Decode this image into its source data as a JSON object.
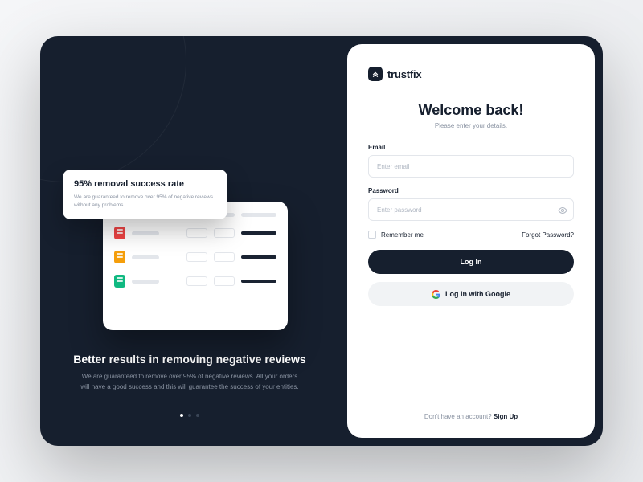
{
  "brand": {
    "name": "trustfix"
  },
  "hero": {
    "callout_title": "95% removal success rate",
    "callout_body": "We are guaranteed to remove over 95% of negative reviews without any problems.",
    "title": "Better results in removing negative reviews",
    "subtitle": "We are guaranteed to remove over 95% of negative reviews. All your orders will have a good success and this will guarantee the success of your entities."
  },
  "auth": {
    "welcome_title": "Welcome back!",
    "welcome_subtitle": "Please enter your details.",
    "email_label": "Email",
    "email_placeholder": "Enter email",
    "password_label": "Password",
    "password_placeholder": "Enter password",
    "remember_label": "Remember me",
    "forgot_label": "Forgot Password?",
    "login_label": "Log In",
    "google_label": "Log In with Google",
    "signup_prompt": "Don't have an account? ",
    "signup_link": "Sign Up"
  }
}
